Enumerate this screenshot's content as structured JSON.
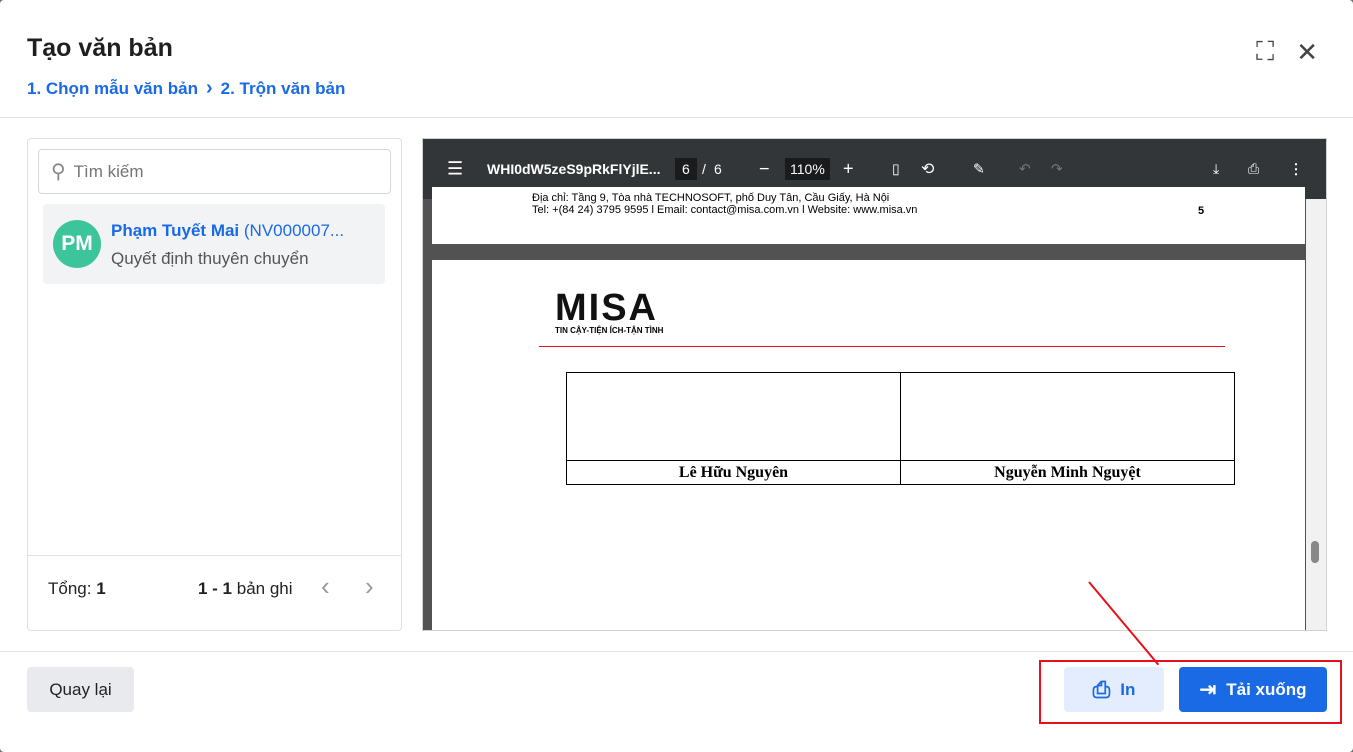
{
  "dialog": {
    "title": "Tạo văn bản",
    "steps": [
      "1. Chọn mẫu văn bản",
      "2. Trộn văn bản"
    ]
  },
  "search": {
    "placeholder": "Tìm kiếm"
  },
  "list": {
    "items": [
      {
        "initials": "PM",
        "name": "Phạm Tuyết Mai",
        "code": "(NV000007...",
        "template": "Quyết định thuyên chuyển"
      }
    ],
    "total_label": "Tổng:",
    "total": "1",
    "range": "1 - 1",
    "range_suffix": "bản ghi"
  },
  "viewer": {
    "filename": "WHI0dW5zeS9pRkFlYjlE...",
    "page": "6",
    "page_sep": "/",
    "page_count": "6",
    "zoom": "110%"
  },
  "doc": {
    "address": "Địa chỉ: Tầng 9, Tòa nhà TECHNOSOFT, phố Duy Tân, Cầu Giấy, Hà Nội",
    "contact": "Tel: +(84 24) 3795 9595 l Email: contact@misa.com.vn  l Website: www.misa.vn",
    "page_number": "5",
    "logo_text": "MISA",
    "logo_tagline": "TIN CẬY-TIỆN ÍCH-TẬN TÌNH",
    "signers": [
      "Lê Hữu Nguyên",
      "Nguyễn Minh Nguyệt"
    ]
  },
  "buttons": {
    "back": "Quay lại",
    "print": "In",
    "download": "Tải xuống"
  },
  "colors": {
    "primary": "#1a6ae5",
    "highlight": "#e8101a"
  }
}
